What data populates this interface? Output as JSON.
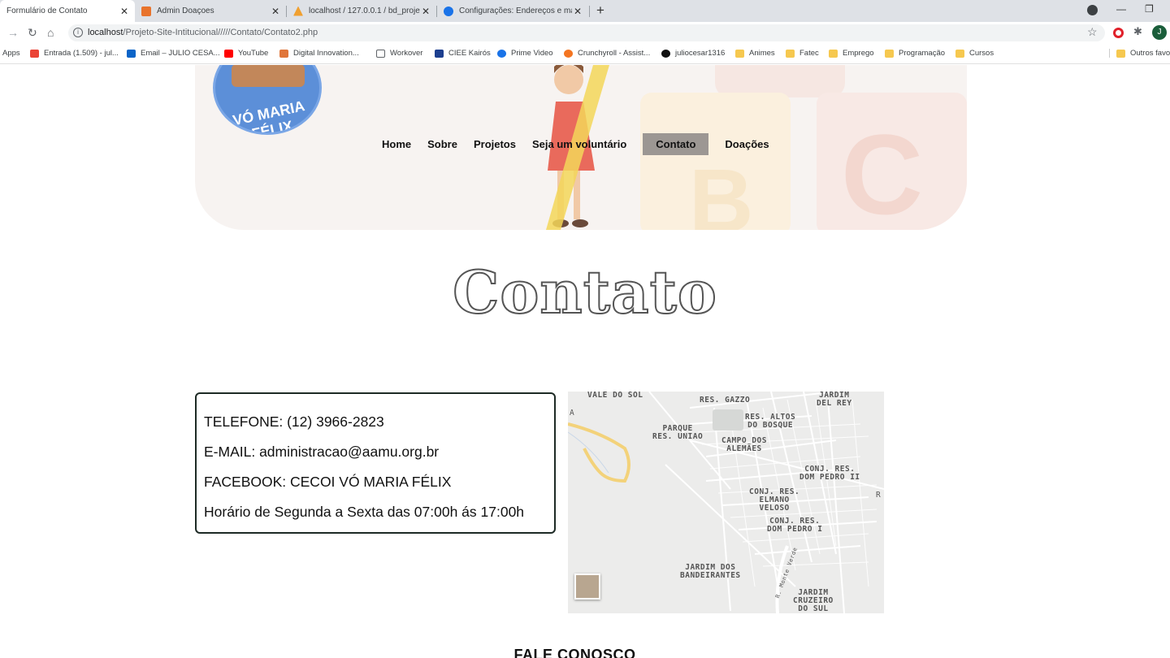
{
  "browser": {
    "tabs": [
      {
        "title": "Formulário de Contato",
        "active": true
      },
      {
        "title": "Admin Doaçoes"
      },
      {
        "title": "localhost / 127.0.0.1 / bd_projeto"
      },
      {
        "title": "Configurações: Endereços e mais"
      }
    ],
    "new_tab_label": "+",
    "url_host": "localhost",
    "url_path": "/Projeto-Site-Intitucional/////Contato/Contato2.php",
    "profile_initial": "J",
    "bookmarks": [
      {
        "label": "Apps"
      },
      {
        "label": "Entrada (1.509) - jul..."
      },
      {
        "label": "Email – JULIO CESA..."
      },
      {
        "label": "YouTube"
      },
      {
        "label": "Digital Innovation..."
      },
      {
        "label": "Workover"
      },
      {
        "label": "CIEE Kairós"
      },
      {
        "label": "Prime Video"
      },
      {
        "label": "Crunchyroll - Assist..."
      },
      {
        "label": "juliocesar1316"
      },
      {
        "label": "Animes"
      },
      {
        "label": "Fatec"
      },
      {
        "label": "Emprego"
      },
      {
        "label": "Programação"
      },
      {
        "label": "Cursos"
      },
      {
        "label": "Outros favo"
      }
    ]
  },
  "site": {
    "logo_text": "VÓ MARIA FÉLIX",
    "nav": [
      {
        "label": "Home"
      },
      {
        "label": "Sobre"
      },
      {
        "label": "Projetos"
      },
      {
        "label": "Seja um voluntário"
      },
      {
        "label": "Contato",
        "active": true
      },
      {
        "label": "Doações"
      }
    ],
    "banner_letters": [
      "B",
      "C"
    ],
    "page_title": "Contato",
    "contact_lines": [
      "TELEFONE: (12) 3966-2823",
      "E-MAIL: administracao@aamu.org.br",
      "FACEBOOK: CECOI VÓ MARIA FÉLIX",
      "Horário de Segunda a Sexta das 07:00h ás 17:00h"
    ],
    "map_labels": [
      "VALE DO SOL",
      "RES. GAZZO",
      "JARDIM\nDEL REY",
      "PARQUE\nRES. UNIAO",
      "RES. ALTOS\nDO BOSQUE",
      "CAMPO DOS\nALEMÃES",
      "CONJ. RES.\nDOM PEDRO II",
      "CONJ. RES.\nELMANO\nVELOSO",
      "CONJ. RES.\nDOM PEDRO I",
      "JARDIM DOS\nBANDEIRANTES",
      "JARDIM\nCRUZEIRO\nDO SUL",
      "R. Monte Verde",
      "R",
      "A"
    ],
    "section_heading": "FALE CONOSCO"
  }
}
